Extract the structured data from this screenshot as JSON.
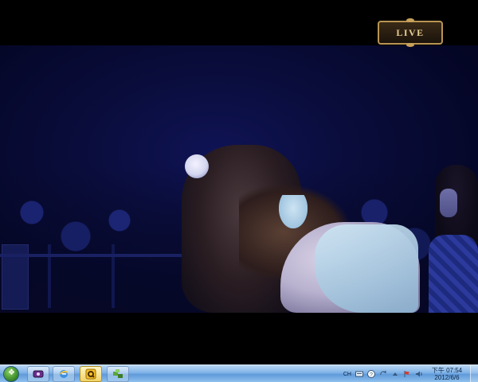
{
  "video": {
    "badge_text": "LIVE"
  },
  "taskbar": {
    "start_label": "Start",
    "apps": [
      {
        "name": "media-player",
        "icon": "tv-icon"
      },
      {
        "name": "internet-explorer",
        "icon": "ie-icon"
      },
      {
        "name": "pplive",
        "icon": "q-app-icon",
        "active": true
      },
      {
        "name": "network-app",
        "icon": "network-icon"
      }
    ]
  },
  "tray": {
    "language": "CH",
    "time": "下午 07:54",
    "date": "2012/6/6"
  },
  "colors": {
    "taskbar": "#7fb2e8",
    "badge_gold": "#b89453"
  }
}
